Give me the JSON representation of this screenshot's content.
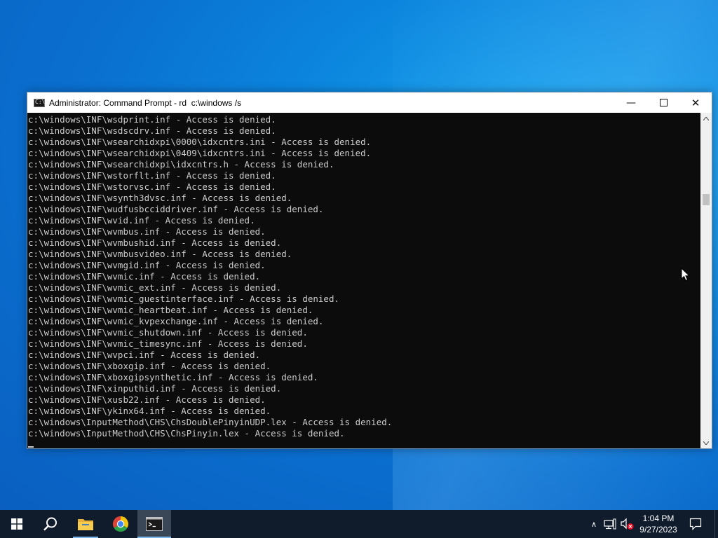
{
  "window": {
    "title": "Administrator: Command Prompt - rd  c:\\windows /s",
    "icon_text": "C:\\_",
    "controls": {
      "minimize_symbol": "—",
      "close_symbol": "✕"
    }
  },
  "console": {
    "lines": [
      "c:\\windows\\INF\\wsdprint.inf - Access is denied.",
      "c:\\windows\\INF\\wsdscdrv.inf - Access is denied.",
      "c:\\windows\\INF\\wsearchidxpi\\0000\\idxcntrs.ini - Access is denied.",
      "c:\\windows\\INF\\wsearchidxpi\\0409\\idxcntrs.ini - Access is denied.",
      "c:\\windows\\INF\\wsearchidxpi\\idxcntrs.h - Access is denied.",
      "c:\\windows\\INF\\wstorflt.inf - Access is denied.",
      "c:\\windows\\INF\\wstorvsc.inf - Access is denied.",
      "c:\\windows\\INF\\wsynth3dvsc.inf - Access is denied.",
      "c:\\windows\\INF\\wudfusbcciddriver.inf - Access is denied.",
      "c:\\windows\\INF\\wvid.inf - Access is denied.",
      "c:\\windows\\INF\\wvmbus.inf - Access is denied.",
      "c:\\windows\\INF\\wvmbushid.inf - Access is denied.",
      "c:\\windows\\INF\\wvmbusvideo.inf - Access is denied.",
      "c:\\windows\\INF\\wvmgid.inf - Access is denied.",
      "c:\\windows\\INF\\wvmic.inf - Access is denied.",
      "c:\\windows\\INF\\wvmic_ext.inf - Access is denied.",
      "c:\\windows\\INF\\wvmic_guestinterface.inf - Access is denied.",
      "c:\\windows\\INF\\wvmic_heartbeat.inf - Access is denied.",
      "c:\\windows\\INF\\wvmic_kvpexchange.inf - Access is denied.",
      "c:\\windows\\INF\\wvmic_shutdown.inf - Access is denied.",
      "c:\\windows\\INF\\wvmic_timesync.inf - Access is denied.",
      "c:\\windows\\INF\\wvpci.inf - Access is denied.",
      "c:\\windows\\INF\\xboxgip.inf - Access is denied.",
      "c:\\windows\\INF\\xboxgipsynthetic.inf - Access is denied.",
      "c:\\windows\\INF\\xinputhid.inf - Access is denied.",
      "c:\\windows\\INF\\xusb22.inf - Access is denied.",
      "c:\\windows\\INF\\ykinx64.inf - Access is denied.",
      "c:\\windows\\InputMethod\\CHS\\ChsDoublePinyinUDP.lex - Access is denied.",
      "c:\\windows\\InputMethod\\CHS\\ChsPinyin.lex - Access is denied."
    ]
  },
  "taskbar": {
    "apps": [
      {
        "name": "start",
        "icon": "windows-logo-icon"
      },
      {
        "name": "search",
        "icon": "search-icon"
      },
      {
        "name": "file-explorer",
        "icon": "folder-icon"
      },
      {
        "name": "chrome",
        "icon": "chrome-icon"
      },
      {
        "name": "command-prompt",
        "icon": "terminal-icon",
        "active": true
      }
    ],
    "tray": {
      "chevron_symbol": "∧",
      "time": "1:04 PM",
      "date": "9/27/2023"
    }
  },
  "colors": {
    "desktop_blue": "#0a6fcf",
    "console_bg": "#0c0c0c",
    "console_text": "#cccccc",
    "taskbar_bg": "#101c2b",
    "volume_mute_badge": "#e81123"
  }
}
